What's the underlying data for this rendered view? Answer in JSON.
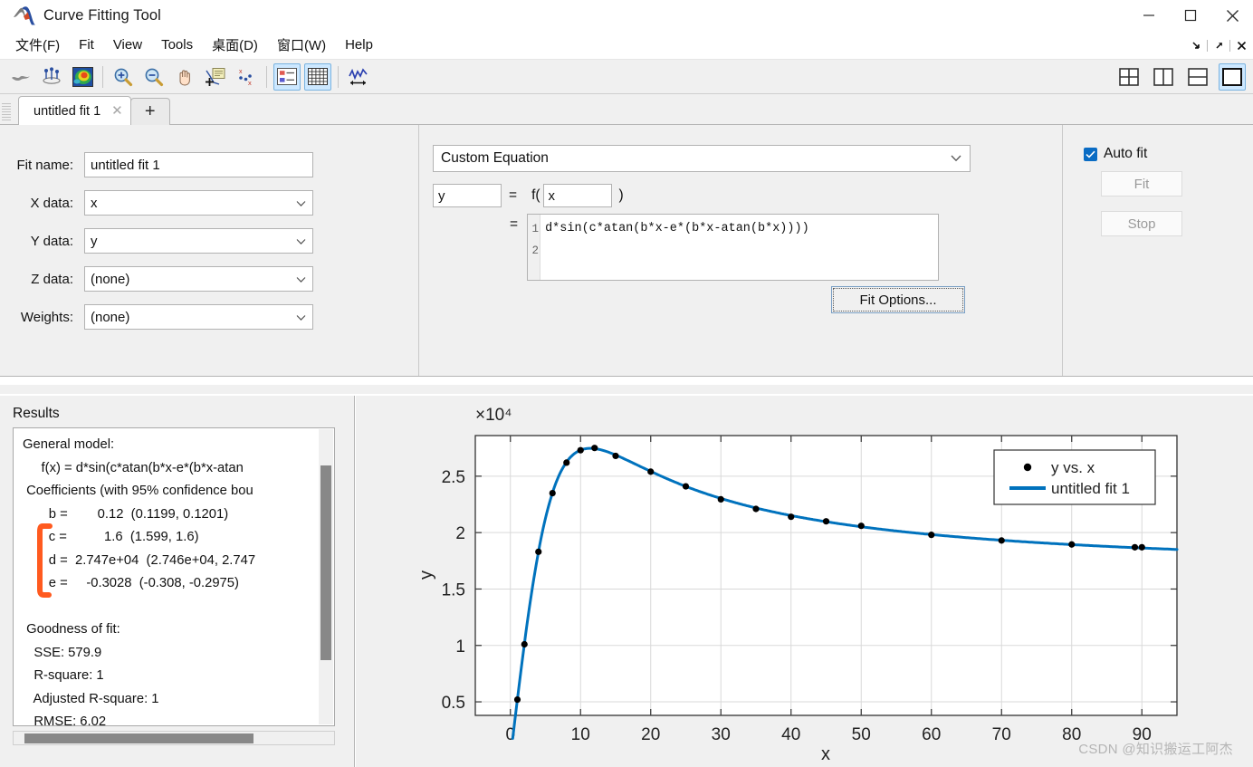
{
  "window": {
    "title": "Curve Fitting Tool",
    "logo_icon": "matlab-logo-icon",
    "controls": [
      {
        "name": "minimize-button",
        "icon": "minimize-icon"
      },
      {
        "name": "maximize-button",
        "icon": "maximize-icon"
      },
      {
        "name": "close-button",
        "icon": "close-icon"
      }
    ]
  },
  "menubar": {
    "items": [
      {
        "label": "文件(F)",
        "name": "menu-file"
      },
      {
        "label": "Fit",
        "name": "menu-fit"
      },
      {
        "label": "View",
        "name": "menu-view"
      },
      {
        "label": "Tools",
        "name": "menu-tools"
      },
      {
        "label": "桌面(D)",
        "name": "menu-desktop"
      },
      {
        "label": "窗口(W)",
        "name": "menu-window"
      },
      {
        "label": "Help",
        "name": "menu-help"
      }
    ],
    "dock_icons": [
      "minimize-panel-icon",
      "undock-icon",
      "close-panel-icon"
    ]
  },
  "toolbar": {
    "buttons": [
      {
        "name": "fit-surface-icon",
        "tooltip": "Rotate 3D"
      },
      {
        "name": "axes-points-icon",
        "tooltip": "Data Cursor 3D"
      },
      {
        "name": "colormap-icon",
        "tooltip": "Colormap"
      },
      {
        "name": "zoom-in-icon",
        "tooltip": "Zoom In"
      },
      {
        "name": "zoom-out-icon",
        "tooltip": "Zoom Out"
      },
      {
        "name": "pan-hand-icon",
        "tooltip": "Pan"
      },
      {
        "name": "data-cursor-icon",
        "tooltip": "Data Cursor"
      },
      {
        "name": "exclude-outliers-icon",
        "tooltip": "Exclude Outliers"
      },
      {
        "name": "legend-icon",
        "tooltip": "Legend",
        "selected": true
      },
      {
        "name": "grid-icon",
        "tooltip": "Grid",
        "selected": true
      },
      {
        "name": "residuals-plot-icon",
        "tooltip": "Prediction Bounds"
      }
    ],
    "layout_buttons": [
      {
        "name": "layout-quad-icon",
        "selected": false
      },
      {
        "name": "layout-vertical-split-icon",
        "selected": false
      },
      {
        "name": "layout-horizontal-split-icon",
        "selected": false
      },
      {
        "name": "layout-single-icon",
        "selected": true
      }
    ]
  },
  "tabs": {
    "items": [
      {
        "label": "untitled fit 1",
        "name": "tab-untitled-fit-1",
        "active": true,
        "close_icon": "close-icon"
      }
    ],
    "add_label": "+",
    "add_name": "add-fit-tab"
  },
  "fit_editor": {
    "fields": [
      {
        "label": "Fit name:",
        "value": "untitled fit 1",
        "type": "text",
        "name": "fit-name-input"
      },
      {
        "label": "X data:",
        "value": "x",
        "type": "select",
        "name": "x-data-select"
      },
      {
        "label": "Y data:",
        "value": "y",
        "type": "select",
        "name": "y-data-select"
      },
      {
        "label": "Z data:",
        "value": "(none)",
        "type": "select",
        "name": "z-data-select"
      },
      {
        "label": "Weights:",
        "value": "(none)",
        "type": "select",
        "name": "weights-select"
      }
    ],
    "equation_type": "Custom Equation",
    "dependent_var": "y",
    "equals_label": "=",
    "f_open": "f(",
    "independent_var": "x",
    "f_close": ")",
    "equation_equals": "=",
    "equation_lines": [
      "d*sin(c*atan(b*x-e*(b*x-atan(b*x))))",
      ""
    ],
    "line_numbers": [
      "1",
      "2"
    ],
    "fit_options_label": "Fit Options...",
    "auto_fit_label": "Auto fit",
    "auto_fit_checked": true,
    "fit_button_label": "Fit",
    "stop_button_label": "Stop"
  },
  "results": {
    "title": "Results",
    "text": "General model:\n     f(x) = d*sin(c*atan(b*x-e*(b*x-atan \n Coefficients (with 95% confidence bou\n       b =        0.12  (0.1199, 0.1201)\n       c =          1.6  (1.599, 1.6)\n       d =  2.747e+04  (2.746e+04, 2.747\n       e =     -0.3028  (-0.308, -0.2975)\n\n Goodness of fit:\n   SSE: 579.9\n   R-square: 1\n   Adjusted R-square: 1\n   RMSE: 6.02",
    "annotation_color": "#FF5A1F"
  },
  "chart_data": {
    "type": "scatter",
    "title": "",
    "xlabel": "x",
    "ylabel": "y",
    "y_exponent_label": "×10⁴",
    "xlim": [
      -5,
      95
    ],
    "ylim": [
      3800,
      28600
    ],
    "xticks": [
      0,
      10,
      20,
      30,
      40,
      50,
      60,
      70,
      80,
      90
    ],
    "yticks": [
      0.5,
      1,
      1.5,
      2,
      2.5
    ],
    "ytick_labels": [
      "0.5",
      "1",
      "1.5",
      "2",
      "2.5"
    ],
    "ytick_values": [
      5000,
      10000,
      15000,
      20000,
      25000
    ],
    "grid": true,
    "legend_position": "top-right",
    "series": [
      {
        "name": "y vs. x",
        "type": "scatter",
        "marker": "circle",
        "color": "#000000",
        "x": [
          1,
          2,
          4,
          6,
          8,
          10,
          12,
          15,
          20,
          25,
          30,
          35,
          40,
          45,
          50,
          60,
          70,
          80,
          89,
          90
        ],
        "y": [
          5200,
          10100,
          18300,
          23500,
          26200,
          27300,
          27500,
          26800,
          25400,
          24100,
          22950,
          22100,
          21400,
          21000,
          20600,
          19800,
          19300,
          18950,
          18700,
          18700
        ]
      },
      {
        "name": "untitled fit 1",
        "type": "line",
        "color": "#0072BD",
        "linewidth": 3,
        "equation": "d*sin(c*atan(b*x-e*(b*x-atan(b*x))))",
        "coefficients": {
          "b": 0.12,
          "c": 1.6,
          "d": 27470,
          "e": -0.3028
        }
      }
    ]
  },
  "watermark": "CSDN @知识搬运工阿杰",
  "colors": {
    "accent_blue": "#0072BD",
    "panel_bg": "#F0F0F0",
    "checkbox_blue": "#0A6CC4",
    "annotation_orange": "#FF5A1F"
  }
}
